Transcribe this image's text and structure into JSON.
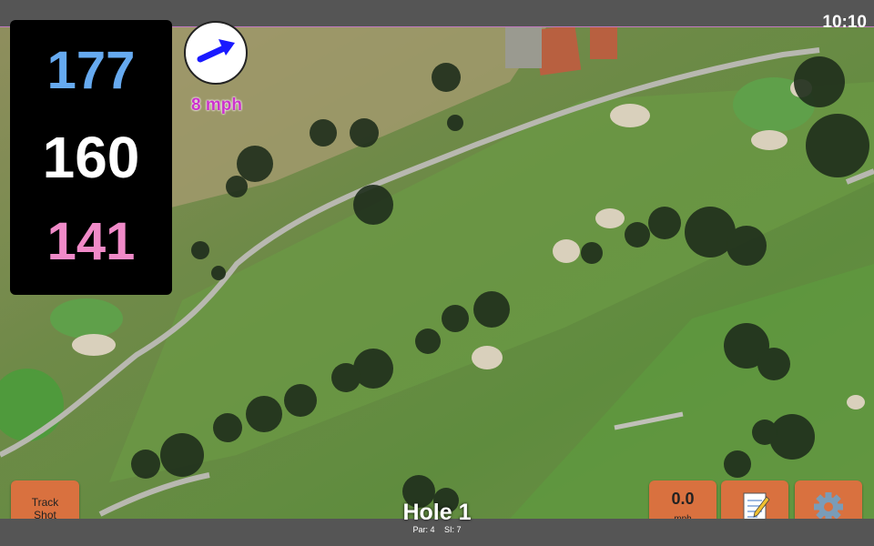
{
  "clock": "10:10",
  "distances": {
    "back": "177",
    "middle": "160",
    "front": "141",
    "colors": {
      "back": "#66aaf0",
      "middle": "#ffffff",
      "front": "#f08ac8"
    }
  },
  "wind": {
    "speed": "8 mph",
    "color": "#cc33cc",
    "arrow_color": "#1a1aff",
    "direction_icon": "arrow-right-icon"
  },
  "buttons": {
    "track_shot_line1": "Track",
    "track_shot_line2": "Shot",
    "speed_value": "0.0",
    "speed_unit": "mph",
    "notes_icon": "notepad-icon",
    "settings_icon": "gear-icon"
  },
  "hole": {
    "title": "Hole 1",
    "par": "Par: 4",
    "si": "SI: 7"
  },
  "colors": {
    "button": "#d9713f",
    "bar": "#555555"
  }
}
